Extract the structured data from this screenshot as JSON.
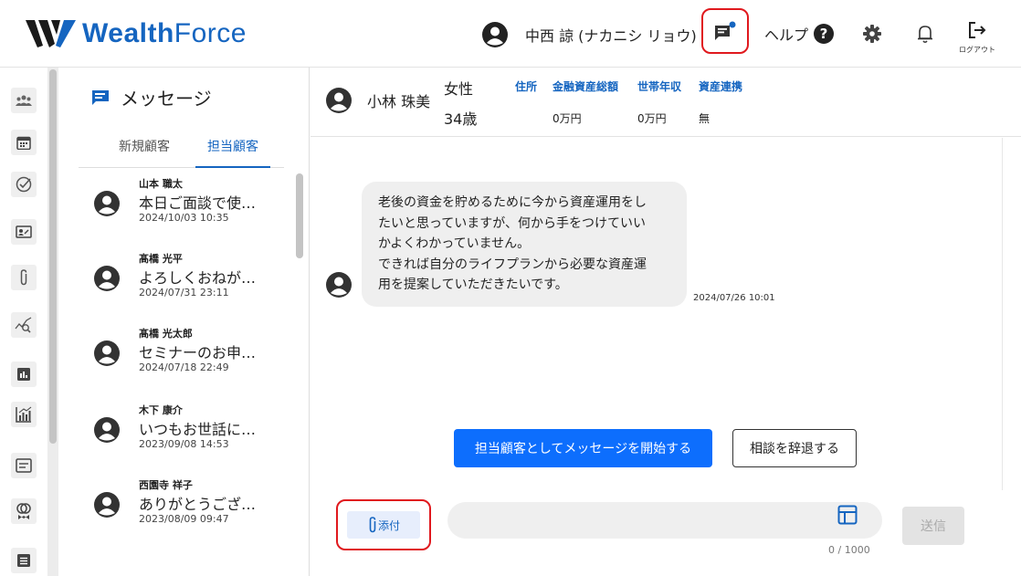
{
  "header": {
    "logo_text_bold": "Wealth",
    "logo_text_thin": "Force",
    "user_name": "中西 諒 (ナカニシ リョウ)",
    "help_label": "ヘルプ",
    "help_icon_glyph": "?",
    "logout_label": "ログアウト",
    "brand_color": "#1565c0",
    "notification_dot_color": "#1565c0"
  },
  "rail": {
    "icons": [
      "team-icon",
      "calendar-icon",
      "check-circle-icon",
      "profile-card-icon",
      "paperclip-icon",
      "chart-search-icon",
      "bar-chart-icon",
      "analytics-icon",
      "document-icon",
      "rings-icon",
      "list-icon"
    ]
  },
  "messages_panel": {
    "title": "メッセージ",
    "tabs": {
      "new": "新規顧客",
      "assigned": "担当顧客"
    },
    "conversations": [
      {
        "name": "山本 職太",
        "preview": "本日ご面談で使…",
        "date": "2024/10/03 10:35"
      },
      {
        "name": "髙橋 光平",
        "preview": "よろしくおねが…",
        "date": "2024/07/31 23:11"
      },
      {
        "name": "髙橋 光太郎",
        "preview": "セミナーのお申…",
        "date": "2024/07/18 22:49"
      },
      {
        "name": "木下 康介",
        "preview": "いつもお世話に…",
        "date": "2023/09/08 14:53"
      },
      {
        "name": "西園寺 祥子",
        "preview": "ありがとうござ…",
        "date": "2023/08/09 09:47"
      }
    ]
  },
  "customer": {
    "name": "小林 珠美",
    "gender": "女性",
    "age": "34歳",
    "address_label": "住所",
    "assets_label": "金融資産総額",
    "assets_value": "0万円",
    "income_label": "世帯年収",
    "income_value": "0万円",
    "link_label": "資産連携",
    "link_value": "無"
  },
  "chat": {
    "message_lines": [
      "老後の資金を貯めるために今から資産運用をし",
      "たいと思っていますが、何から手をつけていい",
      "かよくわかっていません。",
      "できれば自分のライフプランから必要な資産運",
      "用を提案していただきたいです。"
    ],
    "message_time": "2024/07/26 10:01",
    "start_button": "担当顧客としてメッセージを開始する",
    "decline_button": "相談を辞退する",
    "primary_color": "#0d6efd"
  },
  "composer": {
    "attach_label": "添付",
    "counter": "0 / 1000",
    "send_label": "送信",
    "highlight_color": "#e0191e"
  }
}
